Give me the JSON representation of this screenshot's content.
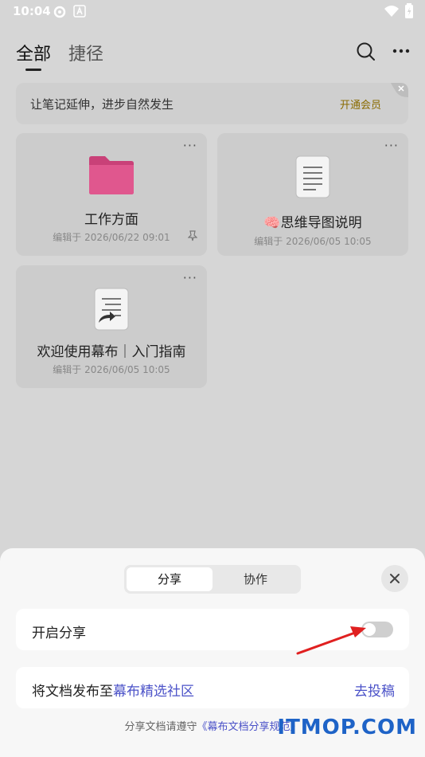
{
  "status": {
    "time": "10:04"
  },
  "header": {
    "tab_all": "全部",
    "tab_shortcut": "捷径"
  },
  "banner": {
    "text": "让笔记延伸，进步自然发生",
    "link": "开通会员"
  },
  "cards": [
    {
      "title": "工作方面",
      "date": "编辑于 2026/06/22 09:01",
      "more": "···"
    },
    {
      "title": "🧠思维导图说明",
      "date": "编辑于 2026/06/05 10:05",
      "more": "···"
    },
    {
      "title": "欢迎使用幕布｜入门指南",
      "date": "编辑于 2026/06/05 10:05",
      "more": "···"
    }
  ],
  "sheet": {
    "seg_share": "分享",
    "seg_collab": "协作",
    "toggle_label": "开启分享",
    "toggle_on": false,
    "publish_prefix": "将文档发布至",
    "publish_link": "幕布精选社区",
    "publish_action": "去投稿",
    "footer_prefix": "分享文档请遵守",
    "footer_link": "《幕布文档分享规范》"
  },
  "watermark": "ITMOP.COM",
  "colors": {
    "folder": "#e0578e",
    "accent": "#4b52c8",
    "arrow": "#e02020"
  }
}
